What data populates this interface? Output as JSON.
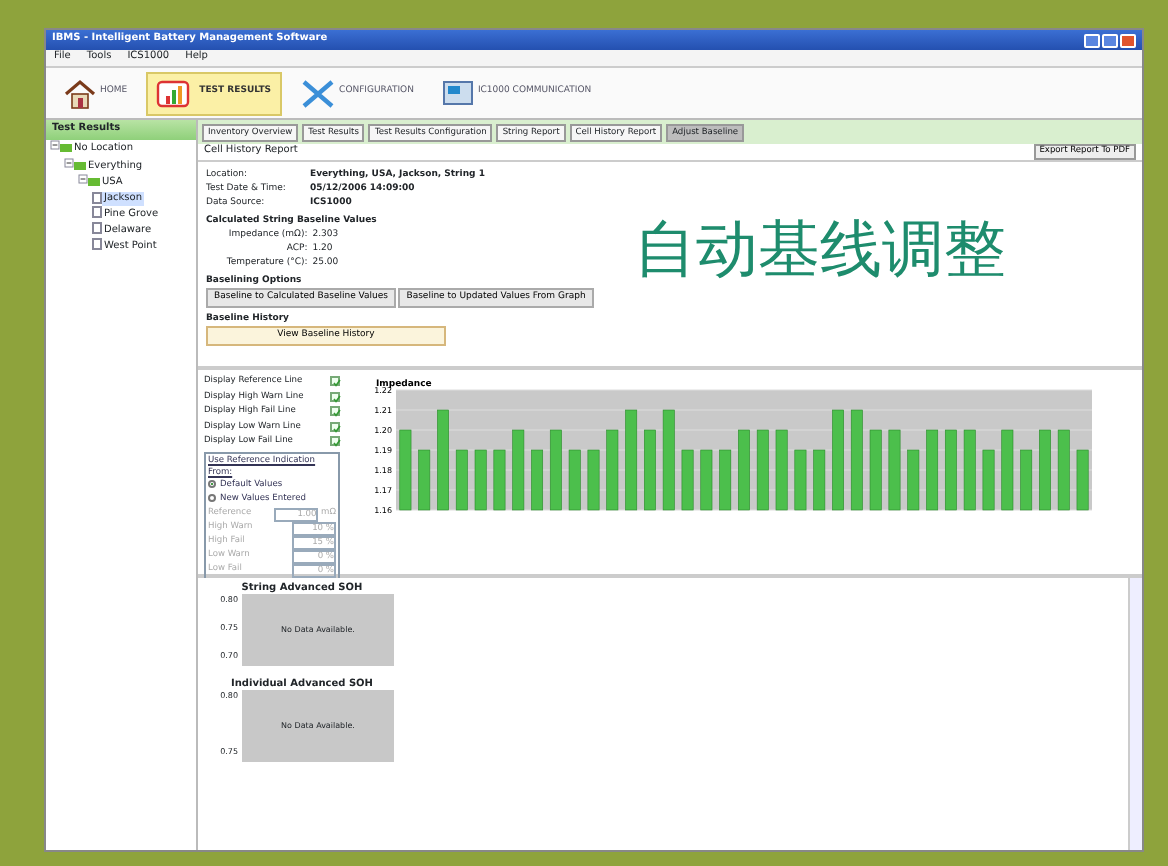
{
  "window": {
    "title": "IBMS - Intelligent Battery Management Software"
  },
  "menu": [
    "File",
    "Tools",
    "ICS1000",
    "Help"
  ],
  "toolbar": [
    {
      "label": "HOME",
      "kind": "home",
      "selected": false
    },
    {
      "label": "TEST RESULTS",
      "kind": "results",
      "selected": true
    },
    {
      "label": "CONFIGURATION",
      "kind": "config",
      "selected": false
    },
    {
      "label": "IC1000 COMMUNICATION",
      "kind": "comm",
      "selected": false
    }
  ],
  "sidebar": {
    "title": "Test Results",
    "tree": [
      {
        "label": "No Location",
        "expanded": true,
        "children": [
          {
            "label": "Everything",
            "expanded": true,
            "children": [
              {
                "label": "USA",
                "expanded": true,
                "children": [
                  {
                    "label": "Jackson",
                    "selected": true
                  },
                  {
                    "label": "Pine Grove",
                    "selected": false
                  },
                  {
                    "label": "Delaware",
                    "selected": false
                  },
                  {
                    "label": "West Point",
                    "selected": false
                  }
                ]
              }
            ]
          }
        ]
      }
    ]
  },
  "tabs": [
    {
      "label": "Inventory Overview",
      "selected": false
    },
    {
      "label": "Test Results",
      "selected": false
    },
    {
      "label": "Test Results Configuration",
      "selected": false
    },
    {
      "label": "String Report",
      "selected": false
    },
    {
      "label": "Cell History Report",
      "selected": false
    },
    {
      "label": "Adjust Baseline",
      "selected": true
    }
  ],
  "report": {
    "title": "Cell History Report",
    "export_button": "Export Report To PDF",
    "info": [
      {
        "label": "Location:",
        "value": "Everything, USA, Jackson, String 1"
      },
      {
        "label": "Test Date & Time:",
        "value": "05/12/2006 14:09:00"
      },
      {
        "label": "Data Source:",
        "value": "ICS1000"
      }
    ],
    "baseline_title": "Calculated String Baseline Values",
    "baseline": [
      {
        "label": "Impedance (mΩ):",
        "value": "2.303"
      },
      {
        "label": "ACP:",
        "value": "1.20"
      },
      {
        "label": "Temperature (°C):",
        "value": "25.00"
      }
    ],
    "options_title": "Baselining Options",
    "options_buttons": [
      "Baseline to Calculated Baseline Values",
      "Baseline to Updated Values From Graph"
    ],
    "history_title": "Baseline History",
    "history_button": "View Baseline History",
    "caption": "自动基线调整"
  },
  "display_options": [
    {
      "label": "Display Reference Line",
      "checked": true
    },
    {
      "label": "Display High Warn Line",
      "checked": true
    },
    {
      "label": "Display High Fail Line",
      "checked": true
    },
    {
      "label": "Display Low Warn Line",
      "checked": true
    },
    {
      "label": "Display Low Fail Line",
      "checked": true
    }
  ],
  "reference": {
    "title": "Use Reference Indication From:",
    "radios": [
      {
        "label": "Default Values",
        "selected": true
      },
      {
        "label": "New Values Entered",
        "selected": false
      }
    ],
    "fields": [
      {
        "label": "Reference",
        "value": "1.00",
        "unit": "mΩ",
        "disabled": true
      },
      {
        "label": "High Warn",
        "value": "10 %",
        "disabled": true
      },
      {
        "label": "High Fail",
        "value": "15 %",
        "disabled": true
      },
      {
        "label": "Low Warn",
        "value": "0 %",
        "disabled": true
      },
      {
        "label": "Low Fail",
        "value": "0 %",
        "disabled": true
      }
    ]
  },
  "chart_data": {
    "type": "bar",
    "title": "Impedance",
    "ylim": [
      1.16,
      1.22
    ],
    "grid": true,
    "yticks": [
      1.16,
      1.17,
      1.18,
      1.19,
      {
        "value": 1.2,
        "label": "1.20"
      },
      1.21,
      1.22
    ],
    "series": [
      {
        "color": "#4cbf4c",
        "values": [
          1.2,
          1.19,
          1.21,
          1.19,
          1.19,
          1.19,
          1.2,
          1.19,
          1.2,
          1.19,
          1.19,
          1.2,
          1.21,
          1.2,
          1.21,
          1.19,
          1.19,
          1.19,
          1.2,
          1.2,
          1.2,
          1.19,
          1.19,
          1.21,
          1.21,
          1.2,
          1.2,
          1.19,
          1.2,
          1.2,
          1.2,
          1.19,
          1.2,
          1.19,
          1.2,
          1.2,
          1.19
        ]
      }
    ]
  },
  "soh_panels": [
    {
      "title": "String Advanced SOH",
      "yticks": [
        "0.80",
        "0.75",
        "0.70"
      ],
      "message": "No Data Available."
    },
    {
      "title": "Individual Advanced SOH",
      "yticks": [
        "0.80",
        "0.75"
      ],
      "message": "No Data Available."
    }
  ]
}
